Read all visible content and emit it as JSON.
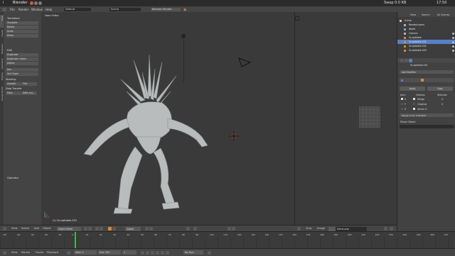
{
  "os_bar": {
    "brand": "i",
    "title": "Blender",
    "app_menus": [
      "File",
      "Render",
      "Window",
      "Help"
    ],
    "tray": {
      "user": "Swap 0.0 KB",
      "clock": "17:50"
    }
  },
  "header": {
    "layout": "Default",
    "scene": "Scene",
    "engine": "Blender Render",
    "menus": [
      "File",
      "Render",
      "Window",
      "Help"
    ]
  },
  "left_tabs": [
    "Tools",
    "Create",
    "Relations",
    "Animation",
    "Physics",
    "Grease Pencil"
  ],
  "left_panel": {
    "sections": [
      {
        "title": "Transform",
        "items": [
          "Translate",
          "Rotate",
          "Scale",
          "Mirror"
        ]
      },
      {
        "title": "Edit",
        "items": [
          "Duplicate",
          "Duplicate Linked",
          "Delete",
          "Join",
          "Set Origin"
        ]
      }
    ],
    "shading": {
      "title": "Shading:",
      "smooth": "Smooth",
      "flat": "Flat"
    },
    "data_transfer": "Data Transfer",
    "data_btns": [
      "Data",
      "Data Lay..."
    ],
    "operator": "Operator"
  },
  "viewport": {
    "view_label": "User Ortho",
    "object_label": "(1) Sculptiable.001"
  },
  "viewport_header": {
    "menus": [
      "View",
      "Select",
      "Add",
      "Object"
    ],
    "mode": "Object Mode",
    "pivot": "Global"
  },
  "image_header": {
    "menus": [
      "View",
      "Image"
    ],
    "image_name": "frame.png"
  },
  "outliner": {
    "header": [
      "View",
      "Search",
      "All Scenes"
    ],
    "rows": [
      {
        "label": "Scene",
        "selected": false,
        "indent": 0
      },
      {
        "label": "RenderLayers",
        "selected": false,
        "indent": 1
      },
      {
        "label": "World",
        "selected": false,
        "indent": 1
      },
      {
        "label": "Camera",
        "selected": false,
        "indent": 1
      },
      {
        "label": "Sculptiable",
        "selected": false,
        "indent": 1
      },
      {
        "label": "Sculptiable.001",
        "selected": true,
        "indent": 1
      },
      {
        "label": "Sculptiable.002",
        "selected": false,
        "indent": 1
      },
      {
        "label": "Sculptiable.003",
        "selected": false,
        "indent": 1
      }
    ]
  },
  "properties": {
    "object": "Sculptiable.001",
    "add_modifier": "Add Modifier",
    "apply": "Apply",
    "copy": "Copy",
    "axis": "Axis:",
    "options": "Options:",
    "textures": "Textures:",
    "axes": [
      "X",
      "Y",
      "Z"
    ],
    "opt_items": [
      "Merge",
      "Clipping",
      "Vertex G"
    ],
    "tex_items": [
      "U",
      "V"
    ],
    "merge_limit": "Merge Limit: 0.001000",
    "mirror_object": "Mirror Object:"
  },
  "timeline": {
    "ticks": [
      "-50",
      "-40",
      "-30",
      "-20",
      "-10",
      "0",
      "10",
      "20",
      "30",
      "40",
      "50",
      "60",
      "70",
      "80",
      "90",
      "100",
      "110",
      "120",
      "130",
      "140",
      "150",
      "160",
      "170",
      "180",
      "190",
      "200",
      "210",
      "220",
      "230",
      "240",
      "250",
      "260",
      "270"
    ]
  },
  "timeline_header": {
    "menus": [
      "View",
      "Marker",
      "Frame",
      "Playback"
    ],
    "start": "Start: 1",
    "end": "End: 250",
    "current": "1",
    "sync": "No Sync"
  },
  "colors": {
    "accent": "#5680c2",
    "bg": "#3a3a3a",
    "header": "#454545",
    "orange": "#e08a2b"
  }
}
